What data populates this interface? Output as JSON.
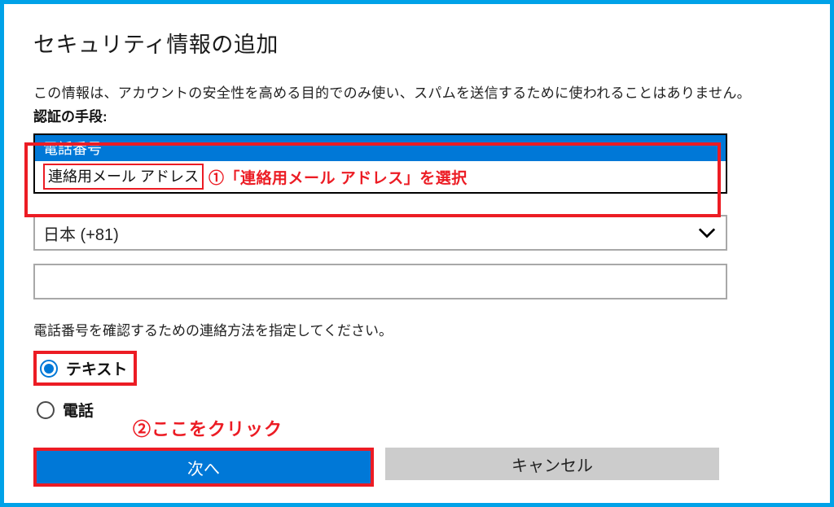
{
  "header": {
    "title": "セキュリティ情報の追加"
  },
  "body": {
    "description": "この情報は、アカウントの安全性を高める目的でのみ使い、スパムを送信するために使われることはありません。",
    "method_label": "認証の手段:"
  },
  "dropdown": {
    "options": {
      "phone": "電話番号",
      "email": "連絡用メール アドレス"
    },
    "selected": "phone"
  },
  "country": {
    "selected": "日本 (+81)"
  },
  "contact": {
    "heading": "電話番号を確認するための連絡方法を指定してください。",
    "radios": {
      "text": "テキスト",
      "call": "電話"
    },
    "selected": "text"
  },
  "buttons": {
    "next": "次へ",
    "cancel": "キャンセル"
  },
  "annotations": {
    "step1": "①「連絡用メール アドレス」を選択",
    "step2": "②ここをクリック"
  }
}
